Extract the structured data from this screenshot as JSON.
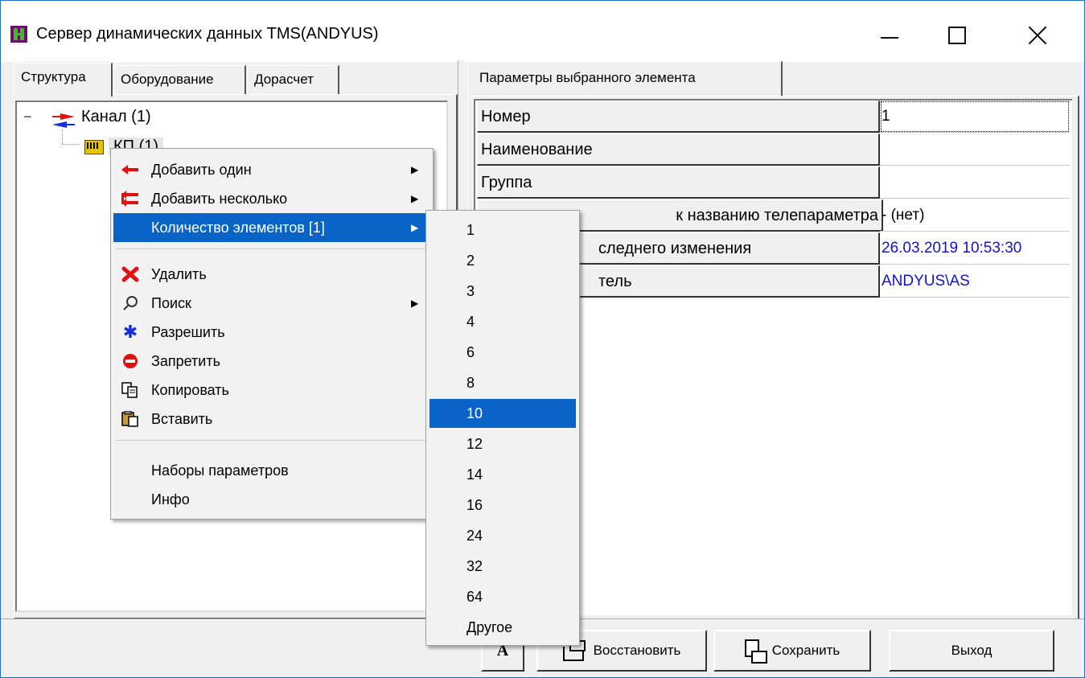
{
  "window": {
    "title": "Сервер динамических данных TMS(ANDYUS)"
  },
  "left_tabs": [
    {
      "label": "Структура",
      "active": true
    },
    {
      "label": "Оборудование",
      "active": false
    },
    {
      "label": "Дорасчет",
      "active": false
    }
  ],
  "tree": {
    "expander": "−",
    "channel_label": "Канал  (1)",
    "kp_label": "КП  (1)"
  },
  "right_tab": {
    "label": "Параметры выбранного элемента"
  },
  "properties": [
    {
      "name": "Номер",
      "value": "1"
    },
    {
      "name": "Наименование",
      "value": ""
    },
    {
      "name": "Группа",
      "value": ""
    },
    {
      "name": "к названию телепараметра",
      "value": "- (нет)"
    },
    {
      "name": "следнего изменения",
      "value": "26.03.2019 10:53:30"
    },
    {
      "name": "тель",
      "value": "ANDYUS\\AS"
    }
  ],
  "context_menu": {
    "items": [
      {
        "label": "Добавить один",
        "icon": "arrow-left-icon",
        "submenu": true
      },
      {
        "label": "Добавить несколько",
        "icon": "double-arrow-left-icon",
        "submenu": true
      },
      {
        "label": "Количество элементов [1]",
        "icon": "",
        "submenu": true,
        "highlighted": true
      },
      {
        "label": "Удалить",
        "icon": "delete-x-icon"
      },
      {
        "label": "Поиск",
        "icon": "search-icon",
        "submenu": true
      },
      {
        "label": "Разрешить",
        "icon": "asterisk-icon"
      },
      {
        "label": "Запретить",
        "icon": "no-entry-icon"
      },
      {
        "label": "Копировать",
        "icon": "copy-icon"
      },
      {
        "label": "Вставить",
        "icon": "paste-icon"
      },
      {
        "label": "Наборы параметров",
        "icon": ""
      },
      {
        "label": "Инфо",
        "icon": ""
      }
    ]
  },
  "count_submenu": {
    "items": [
      "1",
      "2",
      "3",
      "4",
      "6",
      "8",
      "10",
      "12",
      "14",
      "16",
      "24",
      "32",
      "64",
      "Другое"
    ],
    "highlighted": "10"
  },
  "buttons": {
    "font": "A",
    "restore": "Восстановить",
    "save": "Сохранить",
    "exit": "Выход"
  },
  "colors": {
    "accent": "#0a64c8",
    "value_blue": "#1010e0",
    "app_icon_bg": "#6b0f6b",
    "app_icon_fg": "#34c21a"
  }
}
